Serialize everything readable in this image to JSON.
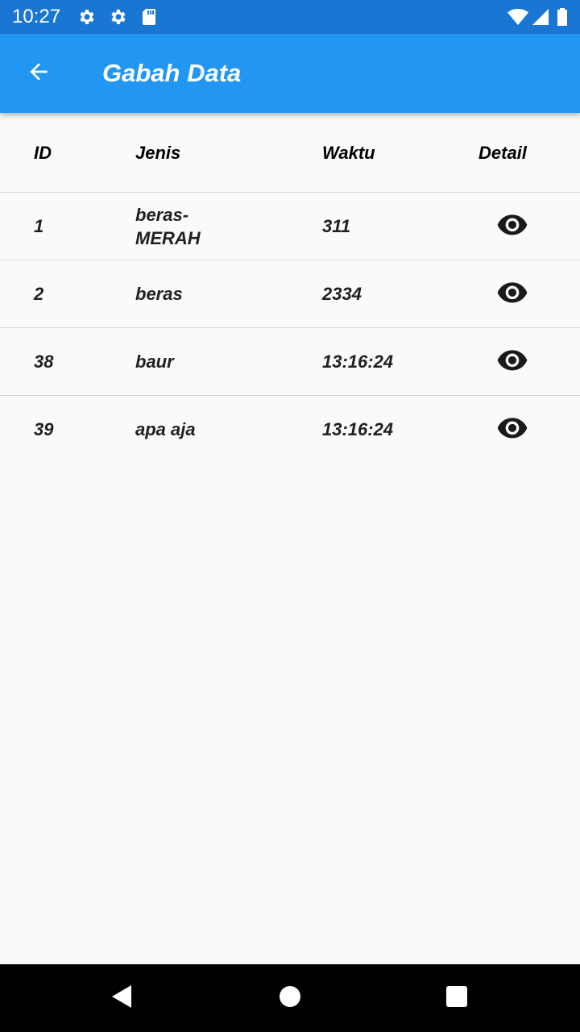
{
  "status_bar": {
    "time": "10:27",
    "left_icons": [
      "gear-icon",
      "gear-icon",
      "sd-card-icon"
    ],
    "right_icons": [
      "wifi-icon",
      "signal-icon",
      "battery-icon"
    ]
  },
  "app_bar": {
    "title": "Gabah Data",
    "back_icon": "arrow-back-icon",
    "color": "#2196f3"
  },
  "table": {
    "headers": {
      "id": "ID",
      "jenis": "Jenis",
      "waktu": "Waktu",
      "detail": "Detail"
    },
    "rows": [
      {
        "id": "1",
        "jenis_line1": "beras-",
        "jenis_line2": "MERAH",
        "waktu": "311",
        "detail_icon": "eye-icon"
      },
      {
        "id": "2",
        "jenis": "beras",
        "waktu": "2334",
        "detail_icon": "eye-icon"
      },
      {
        "id": "38",
        "jenis": "baur",
        "waktu": "13:16:24",
        "detail_icon": "eye-icon"
      },
      {
        "id": "39",
        "jenis": "apa aja",
        "waktu": "13:16:24",
        "detail_icon": "eye-icon"
      }
    ]
  },
  "nav_bar": {
    "buttons": [
      "back-triangle-icon",
      "home-circle-icon",
      "recents-square-icon"
    ]
  },
  "colors": {
    "status_bar": "#1976d2",
    "app_bar": "#2196f3",
    "background": "#fafafa",
    "divider": "#d6d6d6"
  }
}
